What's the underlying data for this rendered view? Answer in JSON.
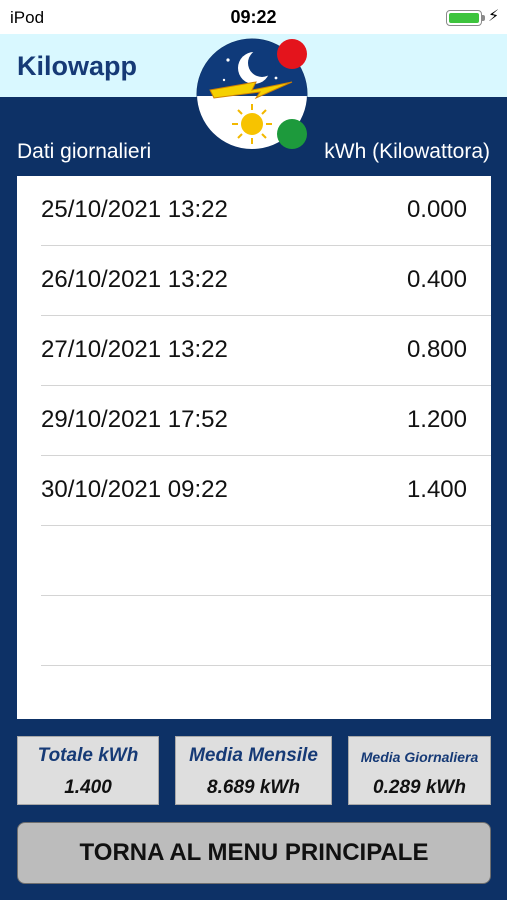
{
  "status_bar": {
    "device": "iPod",
    "time": "09:22",
    "battery_color": "#3dc43d"
  },
  "header": {
    "title": "Kilowapp"
  },
  "logo": {
    "icon_name": "moon-lightning-sun-logo-icon"
  },
  "list_header": {
    "left": "Dati giornalieri",
    "right": "kWh (Kilowattora)"
  },
  "readings": [
    {
      "datetime": "25/10/2021 13:22",
      "value": "0.000"
    },
    {
      "datetime": "26/10/2021 13:22",
      "value": "0.400"
    },
    {
      "datetime": "27/10/2021 13:22",
      "value": "0.800"
    },
    {
      "datetime": "29/10/2021 17:52",
      "value": "1.200"
    },
    {
      "datetime": "30/10/2021 09:22",
      "value": "1.400"
    },
    {
      "datetime": "",
      "value": ""
    },
    {
      "datetime": "",
      "value": ""
    },
    {
      "datetime": "",
      "value": ""
    }
  ],
  "stats": {
    "total": {
      "label": "Totale kWh",
      "value": "1.400"
    },
    "monthly": {
      "label": "Media Mensile",
      "value": "8.689 kWh"
    },
    "daily": {
      "label": "Media Giornaliera",
      "value": "0.289 kWh"
    }
  },
  "main_button": {
    "label": "TORNA AL MENU PRINCIPALE"
  },
  "colors": {
    "background": "#0d3166",
    "header_bg": "#d9f8ff",
    "title": "#163a76",
    "indicator_red": "#e4141c",
    "indicator_green": "#1d9a3c"
  }
}
